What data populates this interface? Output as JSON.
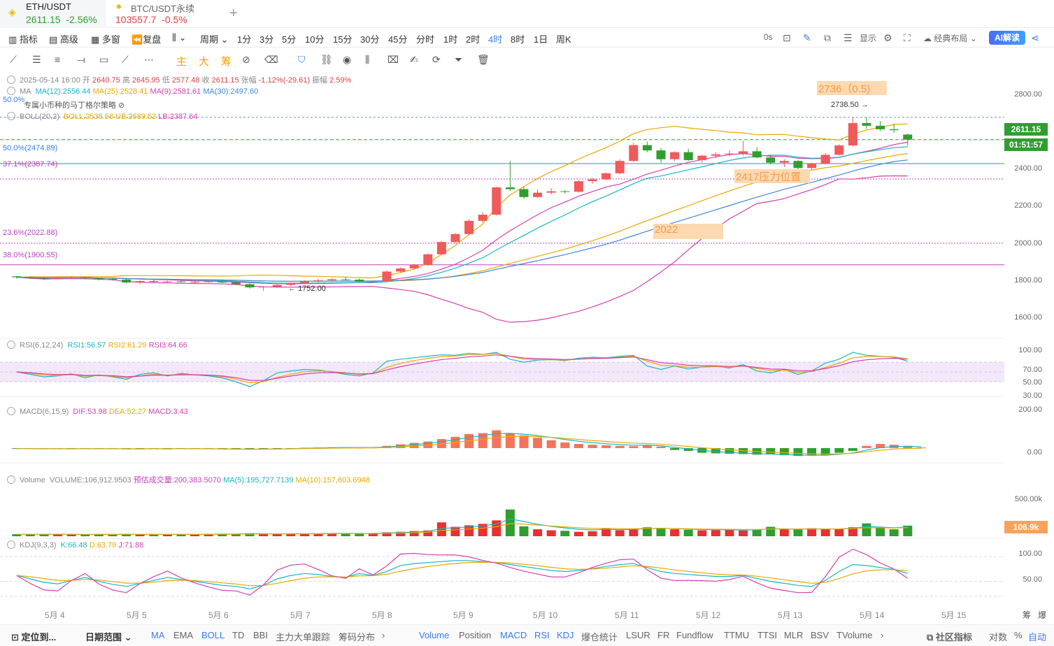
{
  "tabs": [
    {
      "symbol": "ETH/USDT",
      "price": "2611.15",
      "change": "-2.56%"
    },
    {
      "symbol": "BTC/USDT永续",
      "price": "103557.7",
      "change": "-0.5%"
    }
  ],
  "toolbar": {
    "left": [
      "指标",
      "高级",
      "多窗",
      "复盘",
      "周期",
      "1分",
      "3分",
      "5分",
      "10分",
      "15分",
      "30分",
      "45分",
      "分时",
      "1时",
      "2时",
      "4时",
      "8时",
      "1日",
      "周K"
    ],
    "active": "4时",
    "countdown": "0s",
    "display": "显示",
    "layout": "经典布局",
    "ai": "AI解读"
  },
  "legend": {
    "ohlc": {
      "date": "2025-05-14 16:00",
      "open_label": "开",
      "open": "2640.75",
      "high_label": "高",
      "high": "2645.95",
      "low_label": "低",
      "low": "2577.48",
      "close_label": "收",
      "close": "2611.15",
      "change_label": "张幅",
      "change": "-1.12%(-29.61)",
      "amp_label": "振幅",
      "amp": "2.59%"
    },
    "ma": {
      "name": "MA",
      "ma12": "MA(12):2556.44",
      "ma25": "MA(25):2528.41",
      "ma9": "MA(9):2581.61",
      "ma30": "MA(30):2497.60"
    },
    "strategy": "专属小币种的马丁格尔策略",
    "boll": {
      "name": "BOLL(20,2)",
      "boll": "BOLL:2538.58",
      "ub": "UB:2689.52",
      "lb": "LB:2387.64"
    },
    "rsi": {
      "name": "RSI(6,12,24)",
      "r1": "RSI1:56.57",
      "r2": "RSI2:61.29",
      "r3": "RSI3:64.66"
    },
    "macd": {
      "name": "MACD(6,15,9)",
      "dif": "DIF:53.98",
      "dea": "DEA:52.27",
      "macd": "MACD:3.43"
    },
    "volume": {
      "name": "Volume",
      "vol": "VOLUME:106,912.9503",
      "est": "预估成交量:200,383.5070",
      "ma5": "MA(5):195,727.7139",
      "ma10": "MA(10):157,603.6948"
    },
    "kdj": {
      "name": "KDJ(9,3,3)",
      "k": "K:66.48",
      "d": "D:63.79",
      "j": "J:71.88"
    }
  },
  "annotations": {
    "fib": [
      "50.0%",
      "50.0%(2474.89)",
      "37.1%(2387.74)",
      "23.6%(2022.88)",
      "38.0%(1900.55)"
    ],
    "box_2736": "2736（0.5)",
    "high_mark": "2738.50",
    "box_2417": "2417压力位置",
    "box_2022": "2022",
    "low_mark": "1752.00"
  },
  "price_axis": [
    "2800.00",
    "2600.00",
    "2400.00",
    "2200.00",
    "2000.00",
    "1800.00",
    "1600.00"
  ],
  "price_tag": "2611.15",
  "countdown_tag": "01:51:57",
  "rsi_axis": [
    "100.00",
    "70.00",
    "50.00",
    "30.00"
  ],
  "macd_axis": [
    "200.00",
    "0.00"
  ],
  "vol_axis": [
    "500.00k"
  ],
  "vol_tag": "106.9k",
  "kdj_axis": [
    "100.00",
    "50.00"
  ],
  "dates": [
    "5月 4",
    "5月 5",
    "5月 6",
    "5月 7",
    "5月 8",
    "5月 9",
    "5月 10",
    "5月 11",
    "5月 12",
    "5月 13",
    "5月 14",
    "5月 15"
  ],
  "date_right": [
    "筹",
    "爆"
  ],
  "bottom": {
    "locate": "定位到...",
    "range": "日期范围",
    "indicators": [
      "MA",
      "EMA",
      "BOLL",
      "TD",
      "BBI",
      "主力大单跟踪",
      "筹码分布"
    ],
    "sub_indicators": [
      "Volume",
      "Position",
      "MACD",
      "RSI",
      "KDJ",
      "爆仓统计",
      "LSUR",
      "FR",
      "Fundflow",
      "TTMU",
      "TTSI",
      "MLR",
      "BSV",
      "TVolume"
    ],
    "community": "社区指标",
    "log": "对数",
    "pct": "%",
    "auto": "自动"
  },
  "colors": {
    "up": "#f05a5a",
    "down": "#2f9e2f",
    "accent": "#3b7de9",
    "fib": "#c040c0"
  },
  "chart_data": {
    "type": "candlestick",
    "x": [
      "5/3 20:00",
      "5/4 00:00",
      "5/4 04:00",
      "5/4 08:00",
      "5/4 12:00",
      "5/4 16:00",
      "5/4 20:00",
      "5/5 00:00",
      "5/5 04:00",
      "5/5 08:00",
      "5/5 12:00",
      "5/5 16:00",
      "5/5 20:00",
      "5/6 00:00",
      "5/6 04:00",
      "5/6 08:00",
      "5/6 12:00",
      "5/6 16:00",
      "5/6 20:00",
      "5/7 00:00",
      "5/7 04:00",
      "5/7 08:00",
      "5/7 12:00",
      "5/7 16:00",
      "5/7 20:00",
      "5/8 00:00",
      "5/8 04:00",
      "5/8 08:00",
      "5/8 12:00",
      "5/8 16:00",
      "5/8 20:00",
      "5/9 00:00",
      "5/9 04:00",
      "5/9 08:00",
      "5/9 12:00",
      "5/9 16:00",
      "5/9 20:00",
      "5/10 00:00",
      "5/10 04:00",
      "5/10 08:00",
      "5/10 12:00",
      "5/10 16:00",
      "5/10 20:00",
      "5/11 00:00",
      "5/11 04:00",
      "5/11 08:00",
      "5/11 12:00",
      "5/11 16:00",
      "5/11 20:00",
      "5/12 00:00",
      "5/12 04:00",
      "5/12 08:00",
      "5/12 12:00",
      "5/12 16:00",
      "5/12 20:00",
      "5/13 00:00",
      "5/13 04:00",
      "5/13 08:00",
      "5/13 12:00",
      "5/13 16:00",
      "5/13 20:00",
      "5/14 00:00",
      "5/14 04:00",
      "5/14 08:00",
      "5/14 12:00",
      "5/14 16:00"
    ],
    "candles": [
      [
        1835,
        1838,
        1822,
        1830
      ],
      [
        1830,
        1834,
        1820,
        1826
      ],
      [
        1826,
        1830,
        1815,
        1822
      ],
      [
        1822,
        1832,
        1818,
        1828
      ],
      [
        1828,
        1835,
        1822,
        1830
      ],
      [
        1830,
        1832,
        1818,
        1824
      ],
      [
        1824,
        1828,
        1812,
        1820
      ],
      [
        1820,
        1826,
        1810,
        1816
      ],
      [
        1816,
        1822,
        1795,
        1800
      ],
      [
        1800,
        1812,
        1790,
        1808
      ],
      [
        1808,
        1815,
        1800,
        1804
      ],
      [
        1804,
        1810,
        1795,
        1806
      ],
      [
        1806,
        1812,
        1800,
        1802
      ],
      [
        1802,
        1808,
        1796,
        1804
      ],
      [
        1804,
        1810,
        1798,
        1806
      ],
      [
        1806,
        1810,
        1796,
        1800
      ],
      [
        1800,
        1806,
        1785,
        1790
      ],
      [
        1790,
        1795,
        1765,
        1772
      ],
      [
        1772,
        1780,
        1752,
        1776
      ],
      [
        1776,
        1790,
        1770,
        1786
      ],
      [
        1786,
        1800,
        1780,
        1798
      ],
      [
        1798,
        1812,
        1792,
        1808
      ],
      [
        1808,
        1820,
        1800,
        1812
      ],
      [
        1812,
        1825,
        1806,
        1818
      ],
      [
        1818,
        1830,
        1812,
        1816
      ],
      [
        1816,
        1822,
        1800,
        1804
      ],
      [
        1804,
        1812,
        1798,
        1808
      ],
      [
        1808,
        1868,
        1805,
        1862
      ],
      [
        1862,
        1885,
        1855,
        1880
      ],
      [
        1880,
        1905,
        1875,
        1900
      ],
      [
        1900,
        1965,
        1895,
        1960
      ],
      [
        1960,
        2035,
        1955,
        2030
      ],
      [
        2030,
        2080,
        2020,
        2075
      ],
      [
        2075,
        2160,
        2070,
        2150
      ],
      [
        2150,
        2200,
        2140,
        2185
      ],
      [
        2185,
        2345,
        2180,
        2340
      ],
      [
        2340,
        2490,
        2320,
        2330
      ],
      [
        2330,
        2345,
        2275,
        2285
      ],
      [
        2285,
        2330,
        2280,
        2310
      ],
      [
        2310,
        2335,
        2300,
        2318
      ],
      [
        2318,
        2325,
        2305,
        2315
      ],
      [
        2315,
        2380,
        2310,
        2375
      ],
      [
        2375,
        2395,
        2360,
        2385
      ],
      [
        2385,
        2425,
        2380,
        2420
      ],
      [
        2420,
        2500,
        2415,
        2490
      ],
      [
        2490,
        2595,
        2485,
        2580
      ],
      [
        2580,
        2600,
        2540,
        2550
      ],
      [
        2550,
        2565,
        2480,
        2500
      ],
      [
        2500,
        2545,
        2490,
        2540
      ],
      [
        2540,
        2560,
        2490,
        2495
      ],
      [
        2495,
        2525,
        2480,
        2520
      ],
      [
        2520,
        2540,
        2505,
        2528
      ],
      [
        2528,
        2550,
        2515,
        2532
      ],
      [
        2532,
        2605,
        2520,
        2545
      ],
      [
        2545,
        2568,
        2505,
        2510
      ],
      [
        2510,
        2525,
        2470,
        2480
      ],
      [
        2480,
        2500,
        2455,
        2490
      ],
      [
        2490,
        2495,
        2440,
        2450
      ],
      [
        2450,
        2480,
        2440,
        2475
      ],
      [
        2475,
        2535,
        2470,
        2525
      ],
      [
        2525,
        2585,
        2520,
        2578
      ],
      [
        2578,
        2740,
        2570,
        2705
      ],
      [
        2705,
        2738,
        2672,
        2690
      ],
      [
        2690,
        2715,
        2660,
        2670
      ],
      [
        2670,
        2700,
        2650,
        2665
      ],
      [
        2640,
        2646,
        2577,
        2611
      ]
    ],
    "price_range": [
      1550,
      2880
    ],
    "volume": [
      20,
      18,
      19,
      22,
      17,
      16,
      21,
      15,
      24,
      18,
      16,
      20,
      19,
      17,
      23,
      25,
      24,
      30,
      26,
      22,
      27,
      25,
      28,
      32,
      29,
      27,
      31,
      40,
      45,
      52,
      58,
      140,
      95,
      110,
      125,
      160,
      270,
      100,
      70,
      60,
      55,
      45,
      50,
      80,
      60,
      75,
      90,
      85,
      70,
      65,
      60,
      62,
      64,
      58,
      70,
      95,
      72,
      68,
      80,
      70,
      75,
      90,
      130,
      85,
      70,
      107
    ],
    "volume_unit": "k",
    "volume_range": [
      0,
      600
    ],
    "rsi1": [
      50,
      45,
      40,
      42,
      46,
      38,
      44,
      40,
      35,
      45,
      48,
      42,
      47,
      44,
      42,
      38,
      30,
      20,
      32,
      48,
      52,
      55,
      54,
      50,
      45,
      42,
      48,
      72,
      76,
      79,
      82,
      85,
      84,
      88,
      86,
      90,
      76,
      70,
      74,
      75,
      73,
      78,
      80,
      79,
      82,
      84,
      62,
      55,
      62,
      56,
      60,
      62,
      58,
      65,
      52,
      48,
      55,
      45,
      52,
      68,
      76,
      90,
      84,
      82,
      80,
      72
    ],
    "rsi_range": [
      0,
      100
    ],
    "macd_hist": [
      -3,
      -2,
      -4,
      -3,
      -5,
      -2,
      -4,
      -3,
      -6,
      -4,
      -3,
      -5,
      -2,
      -3,
      -4,
      -6,
      -7,
      -8,
      -5,
      -3,
      -1,
      2,
      3,
      5,
      4,
      2,
      3,
      12,
      20,
      28,
      35,
      48,
      60,
      75,
      80,
      95,
      80,
      68,
      55,
      42,
      30,
      22,
      18,
      15,
      12,
      10,
      15,
      8,
      -10,
      -15,
      -25,
      -28,
      -30,
      -32,
      -35,
      -34,
      -38,
      -42,
      -40,
      -38,
      -25,
      -15,
      12,
      22,
      18,
      12,
      3
    ],
    "macd_range": [
      -60,
      220
    ],
    "kdj_k": [
      62,
      55,
      48,
      45,
      52,
      58,
      50,
      44,
      40,
      46,
      52,
      58,
      54,
      50,
      46,
      42,
      40,
      35,
      42,
      55,
      62,
      66,
      64,
      60,
      58,
      66,
      62,
      70,
      82,
      86,
      88,
      90,
      92,
      92,
      90,
      88,
      84,
      80,
      76,
      72,
      70,
      72,
      76,
      80,
      84,
      86,
      78,
      70,
      66,
      64,
      62,
      60,
      60,
      62,
      56,
      50,
      46,
      42,
      40,
      52,
      70,
      84,
      82,
      78,
      74,
      66
    ],
    "kdj_range": [
      0,
      120
    ]
  }
}
